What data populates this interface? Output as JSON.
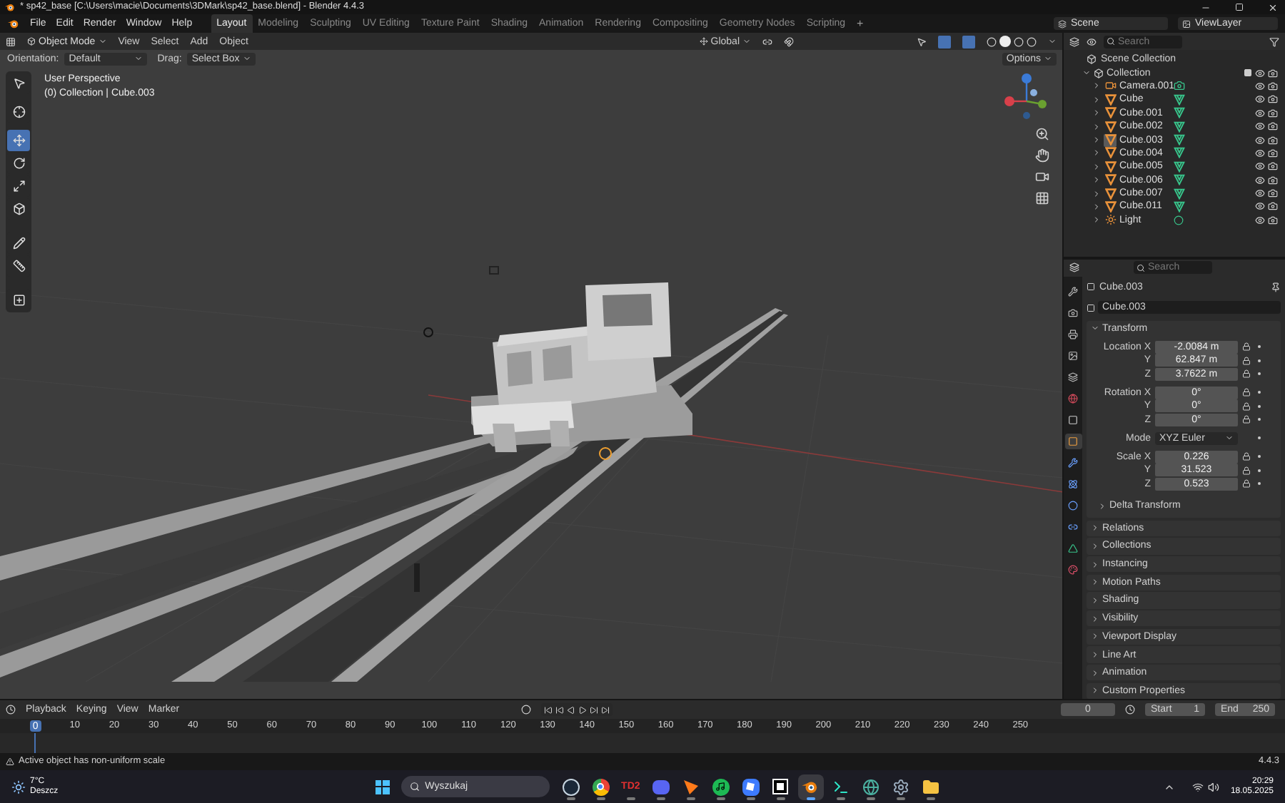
{
  "window": {
    "title": "* sp42_base [C:\\Users\\macie\\Documents\\3DMark\\sp42_base.blend] - Blender 4.4.3"
  },
  "menu": [
    "File",
    "Edit",
    "Render",
    "Window",
    "Help"
  ],
  "workspaces": [
    {
      "label": "Layout",
      "selected": true
    },
    {
      "label": "Modeling",
      "selected": false
    },
    {
      "label": "Sculpting",
      "selected": false
    },
    {
      "label": "UV Editing",
      "selected": false
    },
    {
      "label": "Texture Paint",
      "selected": false
    },
    {
      "label": "Shading",
      "selected": false
    },
    {
      "label": "Animation",
      "selected": false
    },
    {
      "label": "Rendering",
      "selected": false
    },
    {
      "label": "Compositing",
      "selected": false
    },
    {
      "label": "Geometry Nodes",
      "selected": false
    },
    {
      "label": "Scripting",
      "selected": false
    }
  ],
  "add_workspace": "+",
  "scene": "Scene",
  "view_layer": "ViewLayer",
  "viewport": {
    "mode": "Object Mode",
    "menus": [
      "View",
      "Select",
      "Add",
      "Object"
    ],
    "orientation": "Global",
    "options": "Options",
    "orientation_label": "Orientation:",
    "orientation_value": "Default",
    "drag_label": "Drag:",
    "drag_value": "Select Box",
    "view_name": "User Perspective",
    "context": "(0) Collection | Cube.003",
    "tools": [
      {
        "kind": "select",
        "selected": false
      },
      {
        "kind": "cursor",
        "selected": false
      },
      {
        "kind": "move",
        "selected": true
      },
      {
        "kind": "rotate",
        "selected": false
      },
      {
        "kind": "scale",
        "selected": false
      },
      {
        "kind": "transform",
        "selected": false
      },
      {
        "kind": "annotate",
        "selected": false
      },
      {
        "kind": "measure",
        "selected": false
      },
      {
        "kind": "add",
        "selected": false
      }
    ]
  },
  "outliner": {
    "search_placeholder": "Search",
    "root": "Scene Collection",
    "collection": "Collection",
    "expanded": true,
    "items": [
      {
        "name": "Camera.001",
        "kind": "camera",
        "selected": false,
        "expanded": false
      },
      {
        "name": "Cube",
        "kind": "mesh",
        "selected": false,
        "expanded": false
      },
      {
        "name": "Cube.001",
        "kind": "mesh",
        "selected": false,
        "expanded": false
      },
      {
        "name": "Cube.002",
        "kind": "mesh",
        "selected": false,
        "expanded": false
      },
      {
        "name": "Cube.003",
        "kind": "mesh",
        "selected": true,
        "expanded": false
      },
      {
        "name": "Cube.004",
        "kind": "mesh",
        "selected": false,
        "expanded": false
      },
      {
        "name": "Cube.005",
        "kind": "mesh",
        "selected": false,
        "expanded": false
      },
      {
        "name": "Cube.006",
        "kind": "mesh",
        "selected": false,
        "expanded": false
      },
      {
        "name": "Cube.007",
        "kind": "mesh",
        "selected": false,
        "expanded": false
      },
      {
        "name": "Cube.011",
        "kind": "mesh",
        "selected": false,
        "expanded": false
      },
      {
        "name": "Light",
        "kind": "light",
        "selected": false,
        "expanded": false
      }
    ]
  },
  "properties": {
    "search_placeholder": "Search",
    "object_name": "Cube.003",
    "data_name": "Cube.003",
    "tabs": [
      {
        "kind": "tool",
        "selected": false
      },
      {
        "kind": "render",
        "selected": false
      },
      {
        "kind": "output",
        "selected": false
      },
      {
        "kind": "view_layer",
        "selected": false
      },
      {
        "kind": "scene",
        "selected": false
      },
      {
        "kind": "world",
        "selected": false
      },
      {
        "kind": "collection",
        "selected": false
      },
      {
        "kind": "object",
        "selected": true
      },
      {
        "kind": "modifiers",
        "selected": false
      },
      {
        "kind": "particles",
        "selected": false
      },
      {
        "kind": "physics",
        "selected": false
      },
      {
        "kind": "constraints",
        "selected": false
      },
      {
        "kind": "data",
        "selected": false
      },
      {
        "kind": "material",
        "selected": false
      }
    ],
    "transform_title": "Transform",
    "transform_expanded": true,
    "groups": [
      {
        "rows": [
          {
            "label": "Location X",
            "value": "-2.0084 m",
            "kind": "field"
          },
          {
            "label": "Y",
            "value": "62.847 m",
            "kind": "field"
          },
          {
            "label": "Z",
            "value": "3.7622 m",
            "kind": "field"
          }
        ]
      },
      {
        "rows": [
          {
            "label": "Rotation X",
            "value": "0°",
            "kind": "field"
          },
          {
            "label": "Y",
            "value": "0°",
            "kind": "field"
          },
          {
            "label": "Z",
            "value": "0°",
            "kind": "field"
          }
        ]
      },
      {
        "rows": [
          {
            "label": "Mode",
            "value": "XYZ Euler",
            "kind": "dropdown"
          }
        ]
      },
      {
        "rows": [
          {
            "label": "Scale X",
            "value": "0.226",
            "kind": "field"
          },
          {
            "label": "Y",
            "value": "31.523",
            "kind": "field"
          },
          {
            "label": "Z",
            "value": "0.523",
            "kind": "field"
          }
        ]
      }
    ],
    "delta": "Delta Transform",
    "panels": [
      "Relations",
      "Collections",
      "Instancing",
      "Motion Paths",
      "Shading",
      "Visibility",
      "Viewport Display",
      "Line Art",
      "Animation",
      "Custom Properties"
    ]
  },
  "timeline": {
    "menus": [
      "Playback",
      "Keying",
      "View",
      "Marker"
    ],
    "current_frame": "0",
    "start_label": "Start",
    "start": "1",
    "end_label": "End",
    "end": "250",
    "playhead": "0",
    "ticks": [
      "10",
      "20",
      "30",
      "40",
      "50",
      "60",
      "70",
      "80",
      "90",
      "100",
      "110",
      "120",
      "130",
      "140",
      "150",
      "160",
      "170",
      "180",
      "190",
      "200",
      "210",
      "220",
      "230",
      "240",
      "250"
    ]
  },
  "status_bar": {
    "message": "Active object has non-uniform scale",
    "version": "4.4.3"
  },
  "taskbar": {
    "temperature": "7°C",
    "weather": "Deszcz",
    "search_placeholder": "Wyszukaj",
    "apps": [
      {
        "kind": "steam",
        "active": false
      },
      {
        "kind": "browser",
        "active": false
      },
      {
        "kind": "td2",
        "label": "TD2",
        "active": false
      },
      {
        "kind": "chat",
        "active": false
      },
      {
        "kind": "paper",
        "active": false
      },
      {
        "kind": "music",
        "active": false
      },
      {
        "kind": "cube",
        "active": false
      },
      {
        "kind": "terminal_dark",
        "active": false
      },
      {
        "kind": "blender",
        "active": true
      },
      {
        "kind": "terminal",
        "active": false
      },
      {
        "kind": "globe",
        "active": false
      },
      {
        "kind": "settings",
        "active": false
      },
      {
        "kind": "folder",
        "active": false
      }
    ],
    "time": "20:29",
    "date": "18.05.2025"
  }
}
